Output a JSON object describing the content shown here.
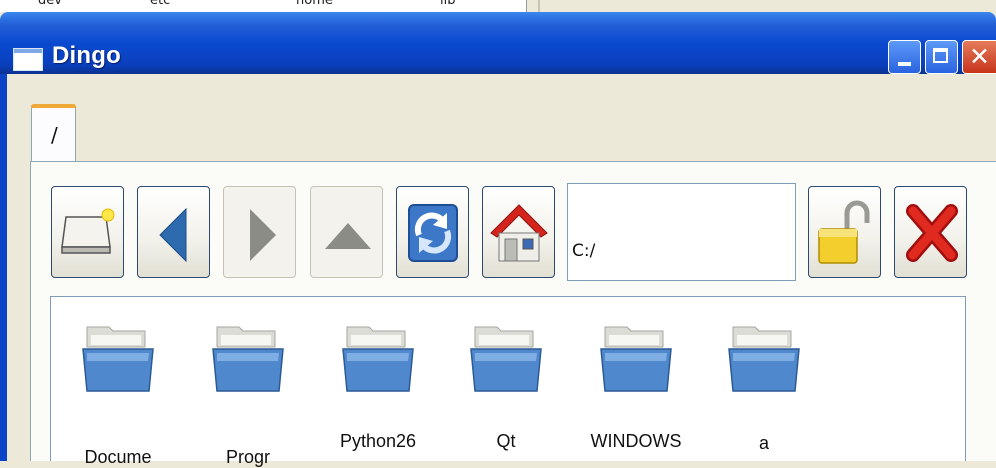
{
  "background_window": {
    "fragments": [
      "dev",
      "etc",
      "home",
      "lib"
    ]
  },
  "window": {
    "title": "Dingo",
    "title_bar_color": "#0a4ad0"
  },
  "tabs": [
    {
      "label": "/"
    }
  ],
  "toolbar": {
    "buttons": [
      {
        "name": "new-drive-button",
        "icon": "drive-icon",
        "enabled": true
      },
      {
        "name": "back-button",
        "icon": "arrow-left-icon",
        "enabled": true
      },
      {
        "name": "forward-button",
        "icon": "arrow-right-icon",
        "enabled": false
      },
      {
        "name": "up-button",
        "icon": "arrow-up-icon",
        "enabled": false
      },
      {
        "name": "refresh-button",
        "icon": "refresh-icon",
        "enabled": true
      },
      {
        "name": "home-button",
        "icon": "home-icon",
        "enabled": true
      },
      {
        "name": "lock-button",
        "icon": "padlock-open-icon",
        "enabled": true
      },
      {
        "name": "close-tab-button",
        "icon": "red-x-icon",
        "enabled": true
      }
    ],
    "address": "C:/"
  },
  "files": [
    {
      "name": "Docume",
      "icon": "folder-icon"
    },
    {
      "name": "Progr",
      "icon": "folder-icon"
    },
    {
      "name": "Python26",
      "icon": "folder-icon"
    },
    {
      "name": "Qt",
      "icon": "folder-icon"
    },
    {
      "name": "WINDOWS",
      "icon": "folder-icon"
    },
    {
      "name": "a",
      "icon": "folder-icon"
    }
  ]
}
